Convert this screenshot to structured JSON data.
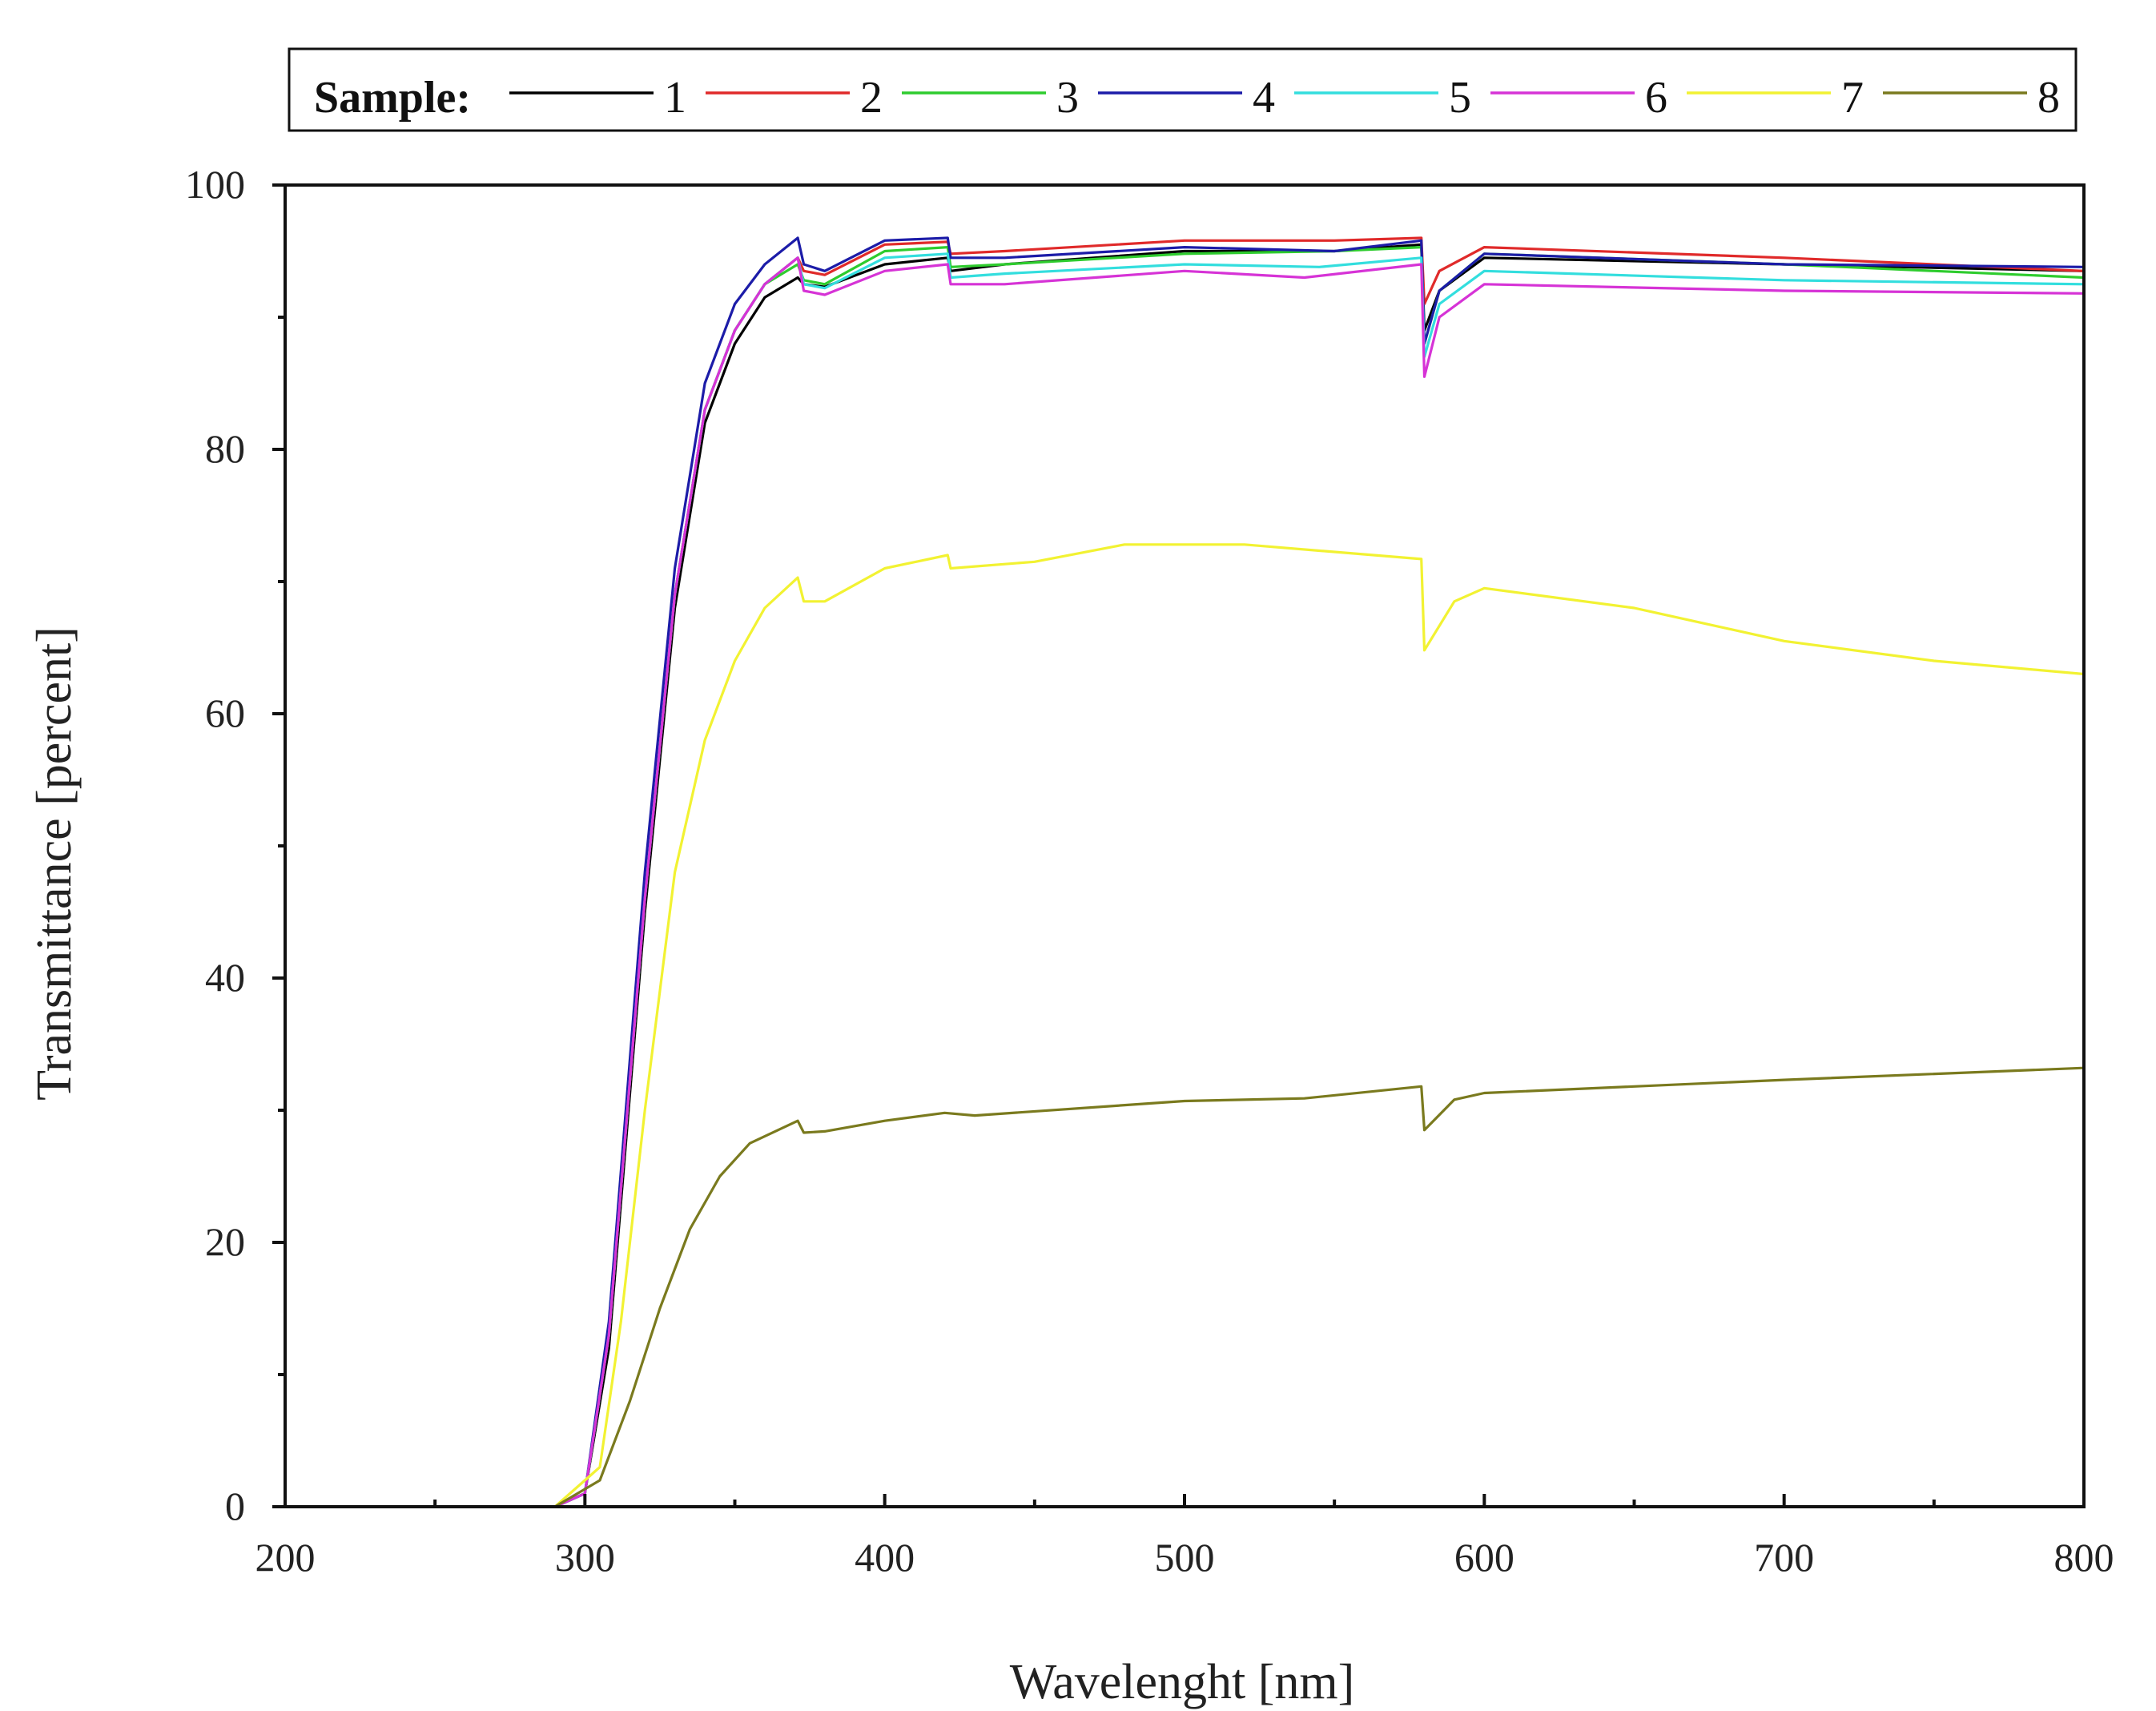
{
  "chart_data": {
    "type": "line",
    "title": "",
    "xlabel": "Wavelenght [nm]",
    "ylabel": "Transmittance [percent]",
    "xlim": [
      200,
      800
    ],
    "ylim": [
      0,
      100
    ],
    "xticks": [
      200,
      300,
      400,
      500,
      600,
      700,
      800
    ],
    "yticks": [
      0,
      20,
      40,
      60,
      80,
      100
    ],
    "grid": false,
    "legend": {
      "title": "Sample:",
      "placement": "top"
    },
    "series": [
      {
        "name": "1",
        "color": "#000000",
        "points": [
          [
            200,
            0
          ],
          [
            290,
            0
          ],
          [
            300,
            1
          ],
          [
            308,
            12
          ],
          [
            320,
            45
          ],
          [
            330,
            68
          ],
          [
            340,
            82
          ],
          [
            350,
            88
          ],
          [
            360,
            91.5
          ],
          [
            371,
            93
          ],
          [
            373,
            92.5
          ],
          [
            380,
            92.3
          ],
          [
            400,
            94
          ],
          [
            421,
            94.5
          ],
          [
            422,
            93.5
          ],
          [
            440,
            94
          ],
          [
            500,
            95
          ],
          [
            550,
            95
          ],
          [
            579,
            95.5
          ],
          [
            580,
            89
          ],
          [
            585,
            92
          ],
          [
            600,
            94.5
          ],
          [
            700,
            94
          ],
          [
            800,
            93.5
          ]
        ]
      },
      {
        "name": "2",
        "color": "#e02a2a",
        "points": [
          [
            200,
            0
          ],
          [
            290,
            0
          ],
          [
            300,
            1
          ],
          [
            308,
            13
          ],
          [
            320,
            46
          ],
          [
            330,
            69
          ],
          [
            340,
            83
          ],
          [
            350,
            89
          ],
          [
            360,
            92.5
          ],
          [
            371,
            94.5
          ],
          [
            373,
            93.5
          ],
          [
            380,
            93.2
          ],
          [
            400,
            95.5
          ],
          [
            421,
            95.7
          ],
          [
            422,
            94.8
          ],
          [
            440,
            95
          ],
          [
            500,
            95.8
          ],
          [
            550,
            95.8
          ],
          [
            579,
            96
          ],
          [
            580,
            91
          ],
          [
            585,
            93.5
          ],
          [
            600,
            95.3
          ],
          [
            700,
            94.5
          ],
          [
            800,
            93.5
          ]
        ]
      },
      {
        "name": "3",
        "color": "#2ecc2e",
        "points": [
          [
            200,
            0
          ],
          [
            290,
            0
          ],
          [
            300,
            1
          ],
          [
            308,
            13
          ],
          [
            320,
            46
          ],
          [
            330,
            69
          ],
          [
            340,
            83
          ],
          [
            350,
            89
          ],
          [
            360,
            92.5
          ],
          [
            371,
            94
          ],
          [
            373,
            92.8
          ],
          [
            380,
            92.5
          ],
          [
            400,
            95
          ],
          [
            421,
            95.3
          ],
          [
            422,
            93.8
          ],
          [
            440,
            94
          ],
          [
            500,
            94.8
          ],
          [
            550,
            95
          ],
          [
            579,
            95.3
          ],
          [
            580,
            88
          ],
          [
            585,
            92
          ],
          [
            600,
            94.8
          ],
          [
            700,
            94
          ],
          [
            800,
            93
          ]
        ]
      },
      {
        "name": "4",
        "color": "#1c1ca8",
        "points": [
          [
            200,
            0
          ],
          [
            290,
            0
          ],
          [
            300,
            1
          ],
          [
            308,
            14
          ],
          [
            320,
            48
          ],
          [
            330,
            71
          ],
          [
            340,
            85
          ],
          [
            350,
            91
          ],
          [
            360,
            94
          ],
          [
            371,
            96
          ],
          [
            373,
            94
          ],
          [
            380,
            93.5
          ],
          [
            400,
            95.8
          ],
          [
            421,
            96
          ],
          [
            422,
            94.5
          ],
          [
            440,
            94.5
          ],
          [
            500,
            95.3
          ],
          [
            550,
            95
          ],
          [
            579,
            95.8
          ],
          [
            580,
            88
          ],
          [
            585,
            92
          ],
          [
            600,
            94.8
          ],
          [
            700,
            94
          ],
          [
            800,
            93.8
          ]
        ]
      },
      {
        "name": "5",
        "color": "#33dede",
        "points": [
          [
            200,
            0
          ],
          [
            290,
            0
          ],
          [
            300,
            1
          ],
          [
            308,
            13
          ],
          [
            320,
            46
          ],
          [
            330,
            69
          ],
          [
            340,
            83
          ],
          [
            350,
            89
          ],
          [
            360,
            92.5
          ],
          [
            371,
            94.5
          ],
          [
            373,
            92.5
          ],
          [
            380,
            92.2
          ],
          [
            400,
            94.5
          ],
          [
            421,
            94.8
          ],
          [
            422,
            93
          ],
          [
            440,
            93.3
          ],
          [
            500,
            94
          ],
          [
            545,
            93.8
          ],
          [
            579,
            94.5
          ],
          [
            580,
            87
          ],
          [
            585,
            91
          ],
          [
            600,
            93.5
          ],
          [
            700,
            92.8
          ],
          [
            800,
            92.5
          ]
        ]
      },
      {
        "name": "6",
        "color": "#d633d6",
        "points": [
          [
            200,
            0
          ],
          [
            290,
            0
          ],
          [
            300,
            1
          ],
          [
            308,
            13
          ],
          [
            320,
            46
          ],
          [
            330,
            69
          ],
          [
            340,
            83
          ],
          [
            350,
            89
          ],
          [
            360,
            92.5
          ],
          [
            371,
            94.5
          ],
          [
            373,
            92
          ],
          [
            380,
            91.7
          ],
          [
            400,
            93.5
          ],
          [
            421,
            94
          ],
          [
            422,
            92.5
          ],
          [
            440,
            92.5
          ],
          [
            500,
            93.5
          ],
          [
            540,
            93
          ],
          [
            579,
            94
          ],
          [
            580,
            85.5
          ],
          [
            585,
            90
          ],
          [
            600,
            92.5
          ],
          [
            700,
            92
          ],
          [
            800,
            91.8
          ]
        ]
      },
      {
        "name": "7",
        "color": "#f2f232",
        "points": [
          [
            200,
            0
          ],
          [
            290,
            0
          ],
          [
            305,
            3
          ],
          [
            312,
            14
          ],
          [
            320,
            30
          ],
          [
            330,
            48
          ],
          [
            340,
            58
          ],
          [
            350,
            64
          ],
          [
            360,
            68
          ],
          [
            371,
            70.3
          ],
          [
            373,
            68.5
          ],
          [
            380,
            68.5
          ],
          [
            400,
            71
          ],
          [
            421,
            72
          ],
          [
            422,
            71
          ],
          [
            450,
            71.5
          ],
          [
            480,
            72.8
          ],
          [
            520,
            72.8
          ],
          [
            579,
            71.7
          ],
          [
            580,
            64.8
          ],
          [
            590,
            68.5
          ],
          [
            600,
            69.5
          ],
          [
            650,
            68
          ],
          [
            700,
            65.5
          ],
          [
            750,
            64
          ],
          [
            800,
            63
          ]
        ]
      },
      {
        "name": "8",
        "color": "#7a7a1e",
        "points": [
          [
            200,
            0
          ],
          [
            290,
            0
          ],
          [
            305,
            2
          ],
          [
            315,
            8
          ],
          [
            325,
            15
          ],
          [
            335,
            21
          ],
          [
            345,
            25
          ],
          [
            355,
            27.5
          ],
          [
            371,
            29.2
          ],
          [
            373,
            28.3
          ],
          [
            380,
            28.4
          ],
          [
            400,
            29.2
          ],
          [
            420,
            29.8
          ],
          [
            430,
            29.6
          ],
          [
            500,
            30.7
          ],
          [
            540,
            30.9
          ],
          [
            579,
            31.8
          ],
          [
            580,
            28.5
          ],
          [
            590,
            30.8
          ],
          [
            600,
            31.3
          ],
          [
            700,
            32.3
          ],
          [
            800,
            33.2
          ]
        ]
      }
    ]
  }
}
